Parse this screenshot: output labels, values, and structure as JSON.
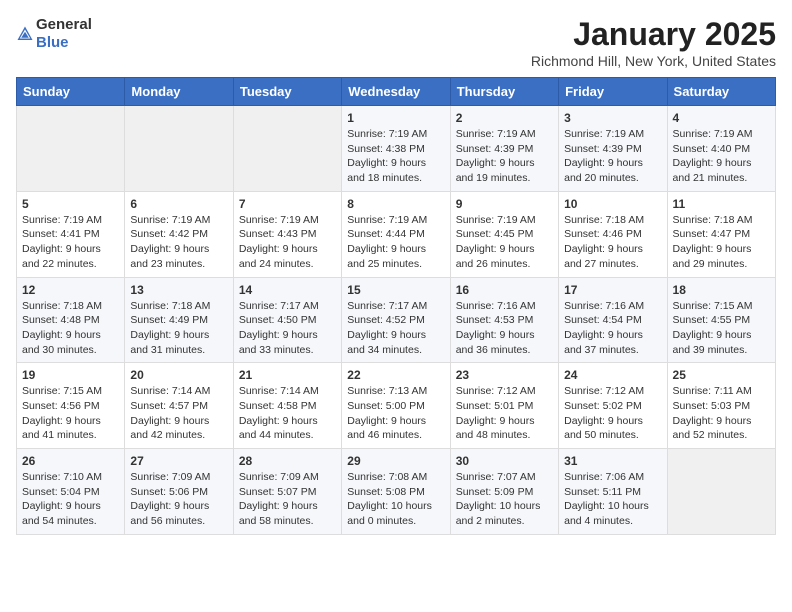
{
  "header": {
    "logo_general": "General",
    "logo_blue": "Blue",
    "month": "January 2025",
    "location": "Richmond Hill, New York, United States"
  },
  "days_of_week": [
    "Sunday",
    "Monday",
    "Tuesday",
    "Wednesday",
    "Thursday",
    "Friday",
    "Saturday"
  ],
  "weeks": [
    [
      {
        "day": "",
        "info": ""
      },
      {
        "day": "",
        "info": ""
      },
      {
        "day": "",
        "info": ""
      },
      {
        "day": "1",
        "info": "Sunrise: 7:19 AM\nSunset: 4:38 PM\nDaylight: 9 hours\nand 18 minutes."
      },
      {
        "day": "2",
        "info": "Sunrise: 7:19 AM\nSunset: 4:39 PM\nDaylight: 9 hours\nand 19 minutes."
      },
      {
        "day": "3",
        "info": "Sunrise: 7:19 AM\nSunset: 4:39 PM\nDaylight: 9 hours\nand 20 minutes."
      },
      {
        "day": "4",
        "info": "Sunrise: 7:19 AM\nSunset: 4:40 PM\nDaylight: 9 hours\nand 21 minutes."
      }
    ],
    [
      {
        "day": "5",
        "info": "Sunrise: 7:19 AM\nSunset: 4:41 PM\nDaylight: 9 hours\nand 22 minutes."
      },
      {
        "day": "6",
        "info": "Sunrise: 7:19 AM\nSunset: 4:42 PM\nDaylight: 9 hours\nand 23 minutes."
      },
      {
        "day": "7",
        "info": "Sunrise: 7:19 AM\nSunset: 4:43 PM\nDaylight: 9 hours\nand 24 minutes."
      },
      {
        "day": "8",
        "info": "Sunrise: 7:19 AM\nSunset: 4:44 PM\nDaylight: 9 hours\nand 25 minutes."
      },
      {
        "day": "9",
        "info": "Sunrise: 7:19 AM\nSunset: 4:45 PM\nDaylight: 9 hours\nand 26 minutes."
      },
      {
        "day": "10",
        "info": "Sunrise: 7:18 AM\nSunset: 4:46 PM\nDaylight: 9 hours\nand 27 minutes."
      },
      {
        "day": "11",
        "info": "Sunrise: 7:18 AM\nSunset: 4:47 PM\nDaylight: 9 hours\nand 29 minutes."
      }
    ],
    [
      {
        "day": "12",
        "info": "Sunrise: 7:18 AM\nSunset: 4:48 PM\nDaylight: 9 hours\nand 30 minutes."
      },
      {
        "day": "13",
        "info": "Sunrise: 7:18 AM\nSunset: 4:49 PM\nDaylight: 9 hours\nand 31 minutes."
      },
      {
        "day": "14",
        "info": "Sunrise: 7:17 AM\nSunset: 4:50 PM\nDaylight: 9 hours\nand 33 minutes."
      },
      {
        "day": "15",
        "info": "Sunrise: 7:17 AM\nSunset: 4:52 PM\nDaylight: 9 hours\nand 34 minutes."
      },
      {
        "day": "16",
        "info": "Sunrise: 7:16 AM\nSunset: 4:53 PM\nDaylight: 9 hours\nand 36 minutes."
      },
      {
        "day": "17",
        "info": "Sunrise: 7:16 AM\nSunset: 4:54 PM\nDaylight: 9 hours\nand 37 minutes."
      },
      {
        "day": "18",
        "info": "Sunrise: 7:15 AM\nSunset: 4:55 PM\nDaylight: 9 hours\nand 39 minutes."
      }
    ],
    [
      {
        "day": "19",
        "info": "Sunrise: 7:15 AM\nSunset: 4:56 PM\nDaylight: 9 hours\nand 41 minutes."
      },
      {
        "day": "20",
        "info": "Sunrise: 7:14 AM\nSunset: 4:57 PM\nDaylight: 9 hours\nand 42 minutes."
      },
      {
        "day": "21",
        "info": "Sunrise: 7:14 AM\nSunset: 4:58 PM\nDaylight: 9 hours\nand 44 minutes."
      },
      {
        "day": "22",
        "info": "Sunrise: 7:13 AM\nSunset: 5:00 PM\nDaylight: 9 hours\nand 46 minutes."
      },
      {
        "day": "23",
        "info": "Sunrise: 7:12 AM\nSunset: 5:01 PM\nDaylight: 9 hours\nand 48 minutes."
      },
      {
        "day": "24",
        "info": "Sunrise: 7:12 AM\nSunset: 5:02 PM\nDaylight: 9 hours\nand 50 minutes."
      },
      {
        "day": "25",
        "info": "Sunrise: 7:11 AM\nSunset: 5:03 PM\nDaylight: 9 hours\nand 52 minutes."
      }
    ],
    [
      {
        "day": "26",
        "info": "Sunrise: 7:10 AM\nSunset: 5:04 PM\nDaylight: 9 hours\nand 54 minutes."
      },
      {
        "day": "27",
        "info": "Sunrise: 7:09 AM\nSunset: 5:06 PM\nDaylight: 9 hours\nand 56 minutes."
      },
      {
        "day": "28",
        "info": "Sunrise: 7:09 AM\nSunset: 5:07 PM\nDaylight: 9 hours\nand 58 minutes."
      },
      {
        "day": "29",
        "info": "Sunrise: 7:08 AM\nSunset: 5:08 PM\nDaylight: 10 hours\nand 0 minutes."
      },
      {
        "day": "30",
        "info": "Sunrise: 7:07 AM\nSunset: 5:09 PM\nDaylight: 10 hours\nand 2 minutes."
      },
      {
        "day": "31",
        "info": "Sunrise: 7:06 AM\nSunset: 5:11 PM\nDaylight: 10 hours\nand 4 minutes."
      },
      {
        "day": "",
        "info": ""
      }
    ]
  ]
}
